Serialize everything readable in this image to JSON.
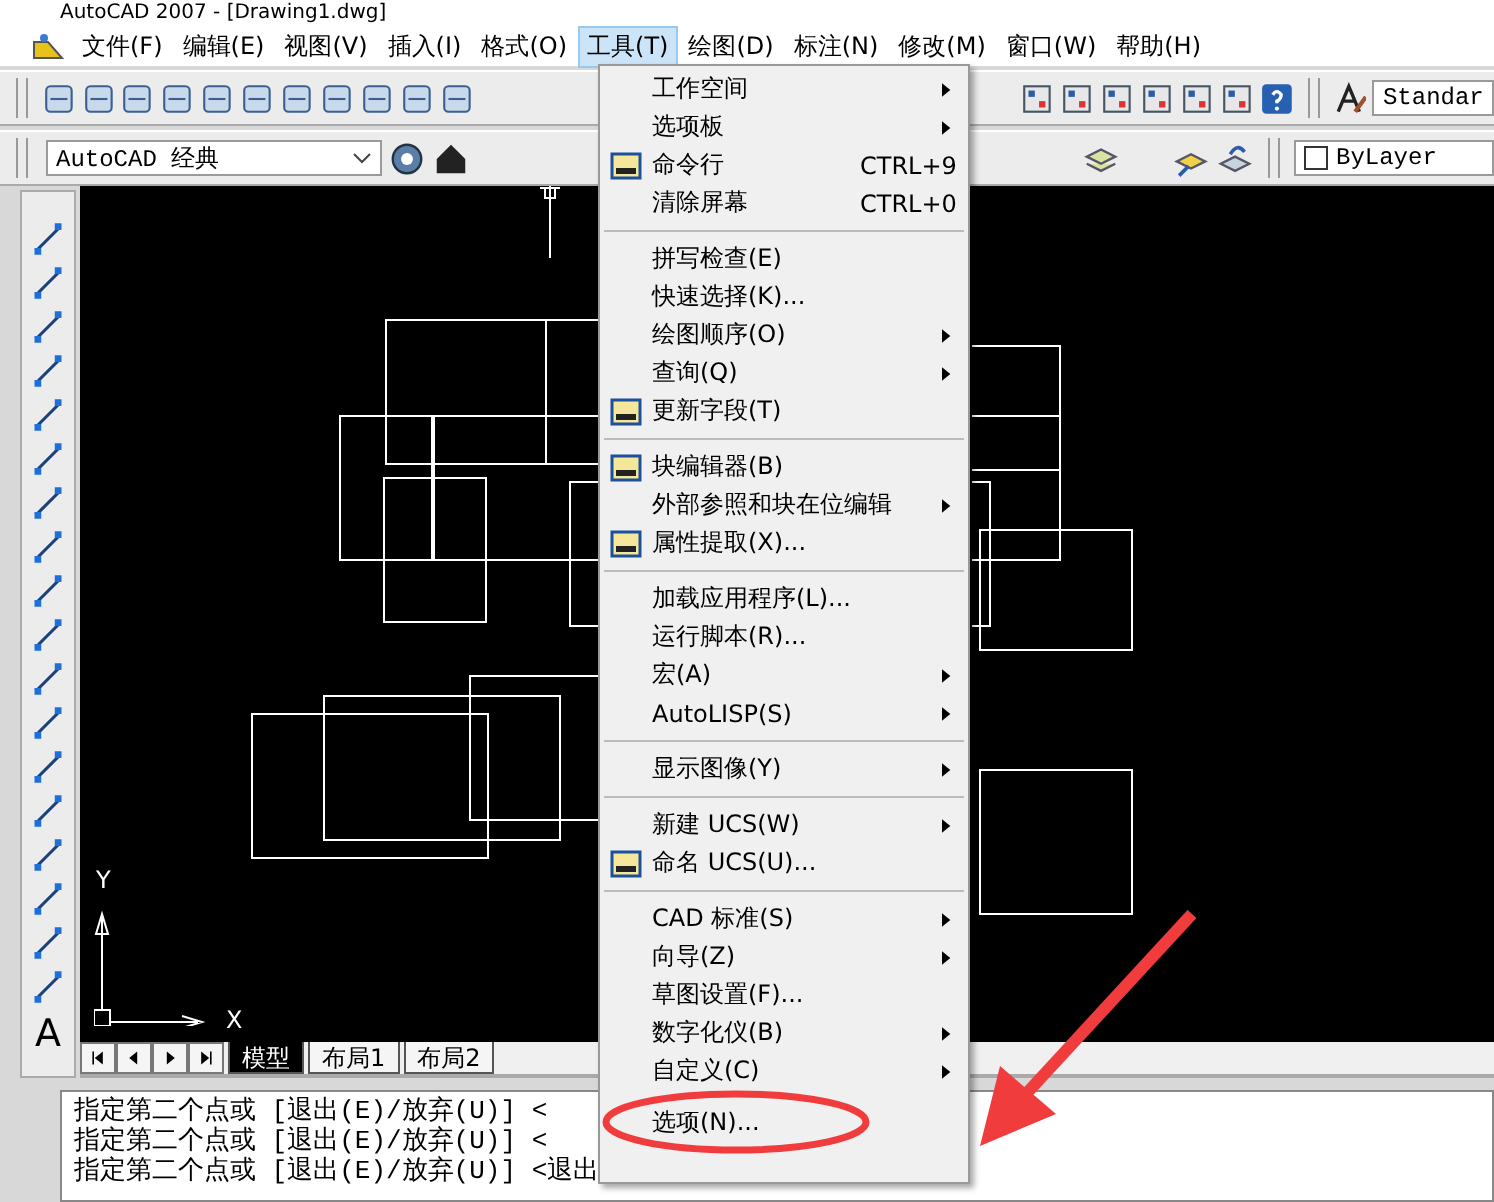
{
  "window": {
    "title": "AutoCAD 2007 - [Drawing1.dwg]"
  },
  "menubar": [
    {
      "label": "文件(F)",
      "selected": false
    },
    {
      "label": "编辑(E)",
      "selected": false
    },
    {
      "label": "视图(V)",
      "selected": false
    },
    {
      "label": "插入(I)",
      "selected": false
    },
    {
      "label": "格式(O)",
      "selected": false
    },
    {
      "label": "工具(T)",
      "selected": true
    },
    {
      "label": "绘图(D)",
      "selected": false
    },
    {
      "label": "标注(N)",
      "selected": false
    },
    {
      "label": "修改(M)",
      "selected": false
    },
    {
      "label": "窗口(W)",
      "selected": false
    },
    {
      "label": "帮助(H)",
      "selected": false
    }
  ],
  "toolbar": {
    "text_style": "Standar",
    "workspace": "AutoCAD 经典",
    "linetype": "ByLayer"
  },
  "draw_toolbar": {
    "text_tool": "A"
  },
  "canvas": {
    "ucs_x": "X",
    "ucs_y": "Y"
  },
  "layout_tabs": [
    {
      "label": "模型",
      "selected": true
    },
    {
      "label": "布局1",
      "selected": false
    },
    {
      "label": "布局2",
      "selected": false
    }
  ],
  "command_lines": [
    "指定第二个点或 [退出(E)/放弃(U)] <",
    "指定第二个点或 [退出(E)/放弃(U)] <",
    "指定第二个点或 [退出(E)/放弃(U)] <退出"
  ],
  "tools_menu": {
    "groups": [
      [
        {
          "label": "工作空间",
          "submenu": true
        },
        {
          "label": "选项板",
          "submenu": true
        },
        {
          "label": "命令行",
          "shortcut": "CTRL+9",
          "submenu": false
        },
        {
          "label": "清除屏幕",
          "shortcut": "CTRL+0",
          "submenu": false
        }
      ],
      [
        {
          "label": "拼写检查(E)",
          "submenu": false
        },
        {
          "label": "快速选择(K)...",
          "submenu": false
        },
        {
          "label": "绘图顺序(O)",
          "submenu": true
        },
        {
          "label": "查询(Q)",
          "submenu": true
        },
        {
          "label": "更新字段(T)",
          "submenu": false
        }
      ],
      [
        {
          "label": "块编辑器(B)",
          "submenu": false
        },
        {
          "label": "外部参照和块在位编辑",
          "submenu": true
        },
        {
          "label": "属性提取(X)...",
          "submenu": false
        }
      ],
      [
        {
          "label": "加载应用程序(L)...",
          "submenu": false
        },
        {
          "label": "运行脚本(R)...",
          "submenu": false
        },
        {
          "label": "宏(A)",
          "submenu": true
        },
        {
          "label": "AutoLISP(S)",
          "submenu": true
        }
      ],
      [
        {
          "label": "显示图像(Y)",
          "submenu": true
        }
      ],
      [
        {
          "label": "新建 UCS(W)",
          "submenu": true
        },
        {
          "label": "命名 UCS(U)...",
          "submenu": false
        }
      ],
      [
        {
          "label": "CAD 标准(S)",
          "submenu": true
        },
        {
          "label": "向导(Z)",
          "submenu": true
        },
        {
          "label": "草图设置(F)...",
          "submenu": false
        },
        {
          "label": "数字化仪(B)",
          "submenu": true
        },
        {
          "label": "自定义(C)",
          "submenu": true
        },
        {
          "label": "选项(N)...",
          "submenu": false,
          "circled": true
        }
      ]
    ]
  }
}
